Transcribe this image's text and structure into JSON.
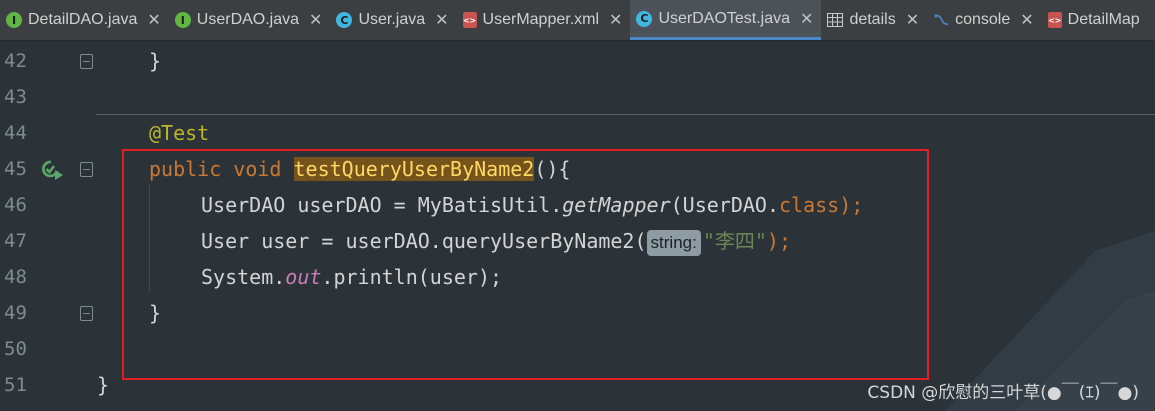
{
  "tabs": [
    {
      "label": "DetailDAO.java",
      "icon": "interface-icon",
      "active": false
    },
    {
      "label": "UserDAO.java",
      "icon": "interface-icon",
      "active": false
    },
    {
      "label": "User.java",
      "icon": "class-icon",
      "active": false
    },
    {
      "label": "UserMapper.xml",
      "icon": "xml-icon",
      "active": false
    },
    {
      "label": "UserDAOTest.java",
      "icon": "test-class-icon",
      "active": true
    },
    {
      "label": "details",
      "icon": "table-icon",
      "active": false
    },
    {
      "label": "console",
      "icon": "console-icon",
      "active": false
    },
    {
      "label": "DetailMap",
      "icon": "xml-icon",
      "active": false
    }
  ],
  "close_glyph": "✕",
  "editor": {
    "line_numbers": [
      "42",
      "43",
      "44",
      "45",
      "46",
      "47",
      "48",
      "49",
      "50",
      "51"
    ],
    "lines": {
      "l42": {
        "brace": "}"
      },
      "l44": {
        "annotation": "@Test"
      },
      "l45": {
        "kw_public": "public",
        "kw_void": "void",
        "method_name": "testQueryUserByName2",
        "rest": "(){"
      },
      "l46": {
        "a": "UserDAO userDAO = MyBatisUtil.",
        "method": "getMapper",
        "b": "(UserDAO.",
        "kw_class": "class",
        "c": ");"
      },
      "l47": {
        "a": "User user = userDAO.queryUserByName2(",
        "hint": "string:",
        "str": "\"李四\"",
        "c": ");"
      },
      "l48": {
        "a": "System.",
        "field": "out",
        "b": ".println(user);"
      },
      "l49": {
        "brace": "}"
      },
      "l51": {
        "brace": "}"
      }
    }
  },
  "watermark": "CSDN @欣慰的三叶草(●￣(ｴ)￣●)",
  "colors": {
    "keyword": "#cc7832",
    "annotation": "#bbb529",
    "string": "#6a8759",
    "static_field": "#c77dbb",
    "highlight_bg": "#75541b",
    "red_box": "#e02020",
    "active_tab_underline": "#4a88c7"
  }
}
